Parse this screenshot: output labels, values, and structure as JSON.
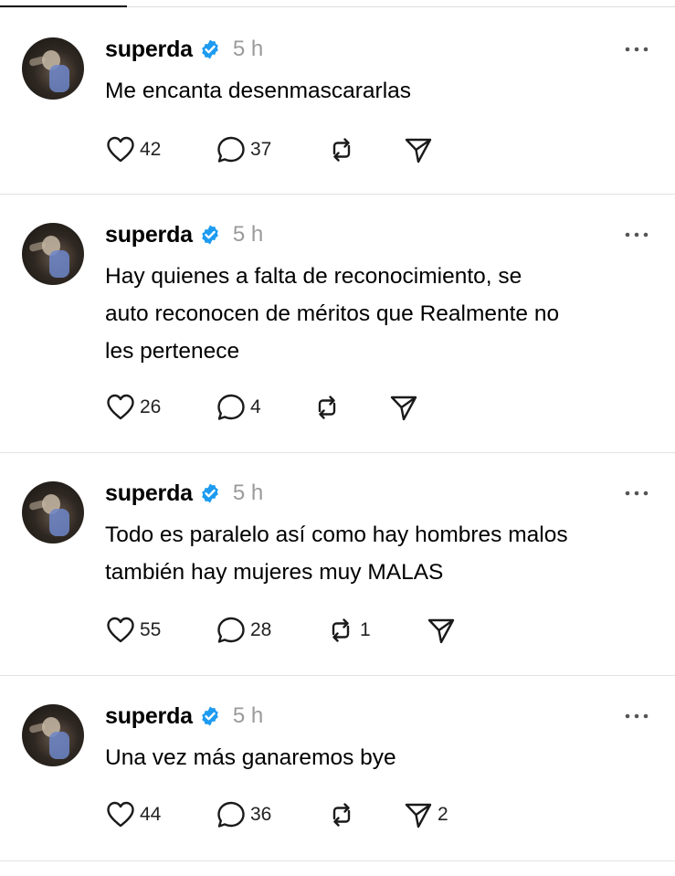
{
  "posts": [
    {
      "username": "superda",
      "time": "5 h",
      "text": [
        "Me encanta desenmascararlas"
      ],
      "likes": "42",
      "replies": "37",
      "reposts": "",
      "shares": ""
    },
    {
      "username": "superda",
      "time": "5 h",
      "text": [
        "Hay quienes a falta de reconocimiento, se",
        "auto reconocen de méritos que Realmente no",
        "les pertenece"
      ],
      "likes": "26",
      "replies": "4",
      "reposts": "",
      "shares": ""
    },
    {
      "username": "superda",
      "time": "5 h",
      "text": [
        "Todo es paralelo así como hay hombres malos",
        "también hay mujeres muy MALAS"
      ],
      "likes": "55",
      "replies": "28",
      "reposts": "1",
      "shares": ""
    },
    {
      "username": "superda",
      "time": "5 h",
      "text": [
        "Una vez más ganaremos bye"
      ],
      "likes": "44",
      "replies": "36",
      "reposts": "",
      "shares": "2"
    }
  ],
  "colors": {
    "verified": "#1d9bf0",
    "muted": "#9a9a9a",
    "divider": "#e2e2e2"
  },
  "icons": {
    "like": "heart-icon",
    "reply": "speech-bubble-icon",
    "repost": "repost-icon",
    "share": "paper-plane-icon",
    "more": "ellipsis-icon",
    "verified": "verified-badge-icon"
  }
}
